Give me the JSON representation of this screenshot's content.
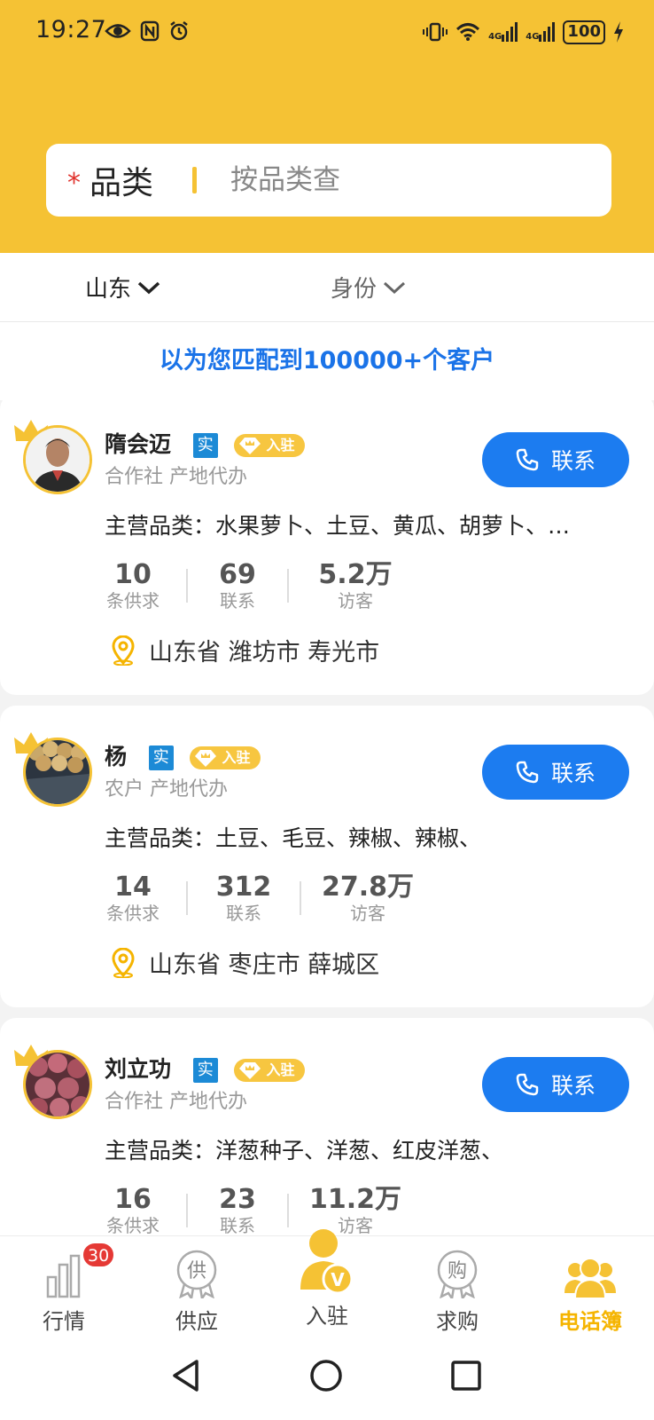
{
  "status_bar": {
    "time": "19:27",
    "battery": "100",
    "network_labels": [
      "4G",
      "4G"
    ]
  },
  "search": {
    "required_mark": "*",
    "category_label": "品类",
    "placeholder": "按品类查"
  },
  "filters": {
    "region": "山东",
    "identity": "身份"
  },
  "match_text": "以为您匹配到100000+个客户",
  "cards": [
    {
      "name": "隋会迈",
      "verified_badge": "实",
      "settled_badge": "入驻",
      "subtitle": "合作社 产地代办",
      "contact_label": "联系",
      "categories": "主营品类：水果萝卜、土豆、黄瓜、胡萝卜、…",
      "stats": [
        {
          "value": "10",
          "label": "条供求"
        },
        {
          "value": "69",
          "label": "联系"
        },
        {
          "value": "5.2万",
          "label": "访客"
        }
      ],
      "location": "山东省 潍坊市 寿光市"
    },
    {
      "name": "杨",
      "verified_badge": "实",
      "settled_badge": "入驻",
      "subtitle": "农户 产地代办",
      "contact_label": "联系",
      "categories": "主营品类：土豆、毛豆、辣椒、辣椒、",
      "stats": [
        {
          "value": "14",
          "label": "条供求"
        },
        {
          "value": "312",
          "label": "联系"
        },
        {
          "value": "27.8万",
          "label": "访客"
        }
      ],
      "location": "山东省 枣庄市 薛城区"
    },
    {
      "name": "刘立功",
      "verified_badge": "实",
      "settled_badge": "入驻",
      "subtitle": "合作社 产地代办",
      "contact_label": "联系",
      "categories": "主营品类：洋葱种子、洋葱、红皮洋葱、",
      "stats": [
        {
          "value": "16",
          "label": "条供求"
        },
        {
          "value": "23",
          "label": "联系"
        },
        {
          "value": "11.2万",
          "label": "访客"
        }
      ],
      "location": ""
    }
  ],
  "tabbar": {
    "market": {
      "label": "行情",
      "badge": "30"
    },
    "supply": {
      "label": "供应",
      "icon_text": "供"
    },
    "settle": {
      "label": "入驻",
      "icon_text": "V"
    },
    "buy": {
      "label": "求购",
      "icon_text": "购"
    },
    "phonebook": {
      "label": "电话簿"
    }
  },
  "colors": {
    "brand_yellow": "#f5c234",
    "primary_blue": "#1c7cf0",
    "active_tab": "#f5b400"
  }
}
